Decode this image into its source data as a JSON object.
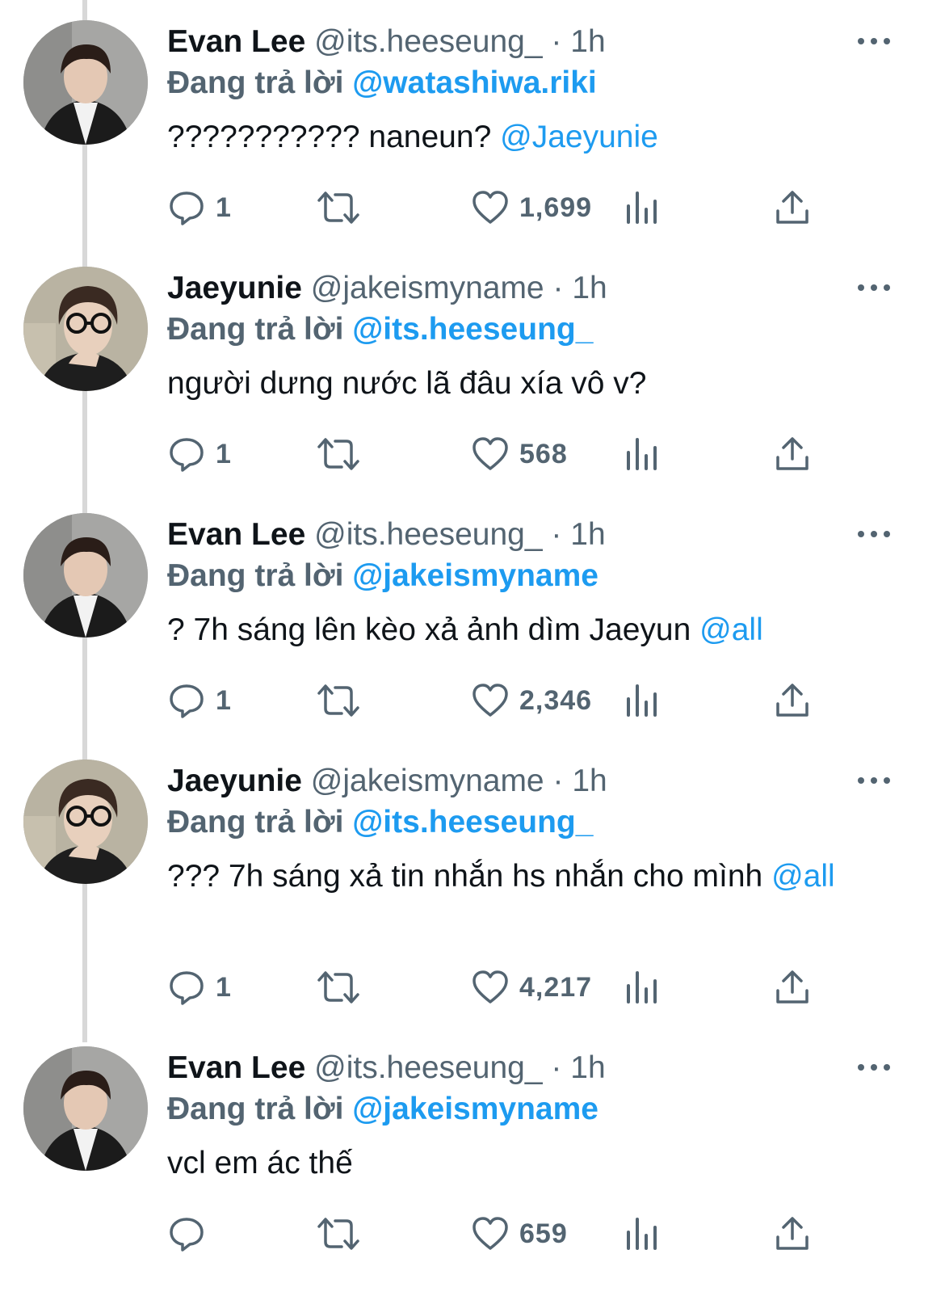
{
  "tweets": [
    {
      "name": "Evan Lee",
      "handle": "@its.heeseung_",
      "time": "1h",
      "reply_prefix": "Đang trả lời",
      "reply_to": "@watashiwa.riki",
      "text": "??????????? naneun?",
      "mention": "@Jaeyunie",
      "replies": "1",
      "likes": "1,699"
    },
    {
      "name": "Jaeyunie",
      "handle": "@jakeismyname",
      "time": "1h",
      "reply_prefix": "Đang trả lời",
      "reply_to": "@its.heeseung_",
      "text": "người dưng nước lã đâu xía vô v?",
      "mention": "",
      "replies": "1",
      "likes": "568"
    },
    {
      "name": "Evan Lee",
      "handle": "@its.heeseung_",
      "time": "1h",
      "reply_prefix": "Đang trả lời",
      "reply_to": "@jakeismyname",
      "text": "? 7h sáng lên kèo xả ảnh dìm Jaeyun",
      "mention": "@all",
      "replies": "1",
      "likes": "2,346"
    },
    {
      "name": "Jaeyunie",
      "handle": "@jakeismyname",
      "time": "1h",
      "reply_prefix": "Đang trả lời",
      "reply_to": "@its.heeseung_",
      "text": "??? 7h sáng xả tin nhắn hs nhắn cho mình",
      "mention": "@all",
      "replies": "1",
      "likes": "4,217"
    },
    {
      "name": "Evan Lee",
      "handle": "@its.heeseung_",
      "time": "1h",
      "reply_prefix": "Đang trả lời",
      "reply_to": "@jakeismyname",
      "text": "vcl em ác thế",
      "mention": "",
      "replies": "",
      "likes": "659"
    }
  ],
  "icons": {
    "reply": "reply-icon",
    "retweet": "retweet-icon",
    "like": "heart-icon",
    "views": "views-icon",
    "share": "share-icon",
    "more": "more-icon"
  },
  "colors": {
    "text": "#0f1419",
    "secondary": "#536471",
    "accent": "#1d9bf0",
    "thread_line": "#d8d8d8"
  }
}
